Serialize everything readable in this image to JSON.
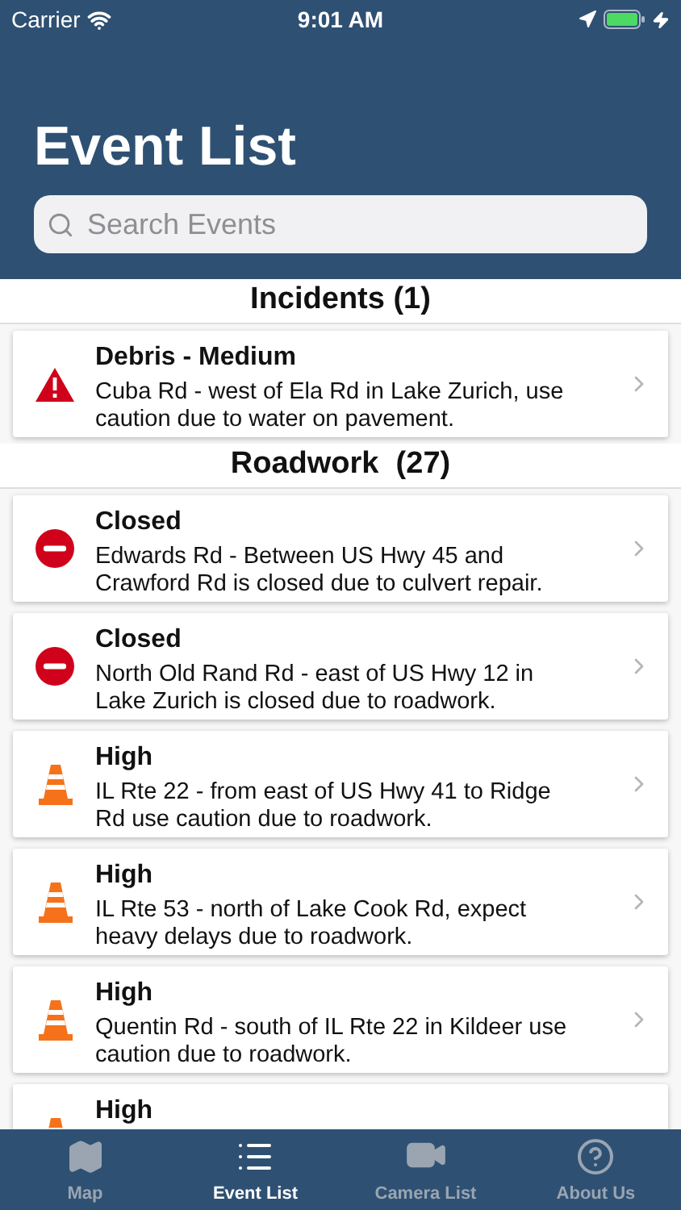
{
  "status_bar": {
    "carrier": "Carrier",
    "time": "9:01 AM"
  },
  "title": "Event List",
  "search": {
    "placeholder": "Search Events"
  },
  "sections": [
    {
      "title": "Incidents (1)",
      "items": [
        {
          "kind": "warning",
          "title": "Debris - Medium",
          "description": "Cuba Rd - west of Ela Rd in Lake Zurich, use caution due to water on pavement."
        }
      ]
    },
    {
      "title": "Roadwork  (27)",
      "items": [
        {
          "kind": "closed",
          "title": "Closed",
          "description": "Edwards Rd - Between US Hwy 45 and Crawford Rd is closed due to culvert repair."
        },
        {
          "kind": "closed",
          "title": "Closed",
          "description": "North Old Rand Rd - east of US Hwy 12 in Lake Zurich is closed due to roadwork."
        },
        {
          "kind": "cone",
          "title": "High",
          "description": "IL Rte 22 - from east of US Hwy 41 to Ridge Rd use caution due to roadwork."
        },
        {
          "kind": "cone",
          "title": "High",
          "description": "IL Rte 53 - north of Lake Cook Rd, expect heavy delays due to roadwork."
        },
        {
          "kind": "cone",
          "title": "High",
          "description": "Quentin Rd - south of IL Rte 22 in Kildeer use caution due to roadwork."
        },
        {
          "kind": "cone",
          "title": "High"
        }
      ]
    }
  ],
  "tabs": [
    {
      "kind": "map",
      "label": "Map",
      "selected": false
    },
    {
      "kind": "list",
      "label": "Event List",
      "selected": true
    },
    {
      "kind": "camera",
      "label": "Camera List",
      "selected": false
    },
    {
      "kind": "help",
      "label": "About Us",
      "selected": false
    }
  ]
}
